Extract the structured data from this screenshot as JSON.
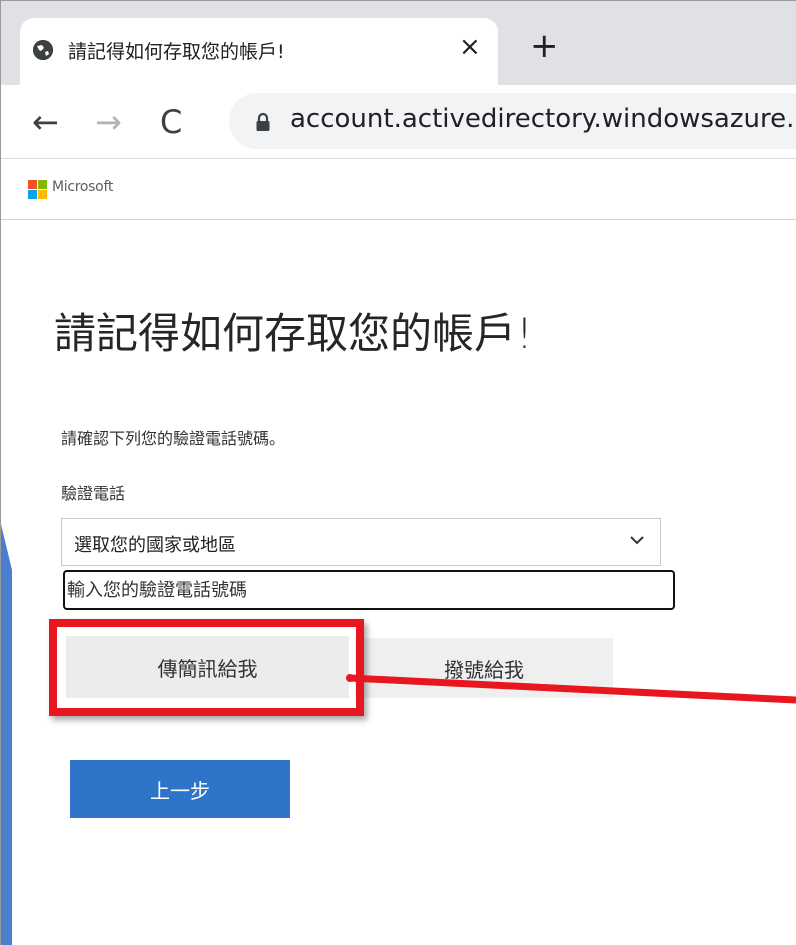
{
  "browser": {
    "tab_title": "請記得如何存取您的帳戶!",
    "tab_close": "×",
    "new_tab": "+",
    "url": "account.activedirectory.windowsazure.",
    "back_icon": "←",
    "forward_icon": "→",
    "reload_icon": "C"
  },
  "brand": {
    "name": "Microsoft",
    "logo_colors": [
      "#f25022",
      "#7fba00",
      "#00a4ef",
      "#ffb900"
    ]
  },
  "page": {
    "heading": "請記得如何存取您的帳戶!",
    "instruction": "請確認下列您的驗證電話號碼。",
    "field_label": "驗證電話",
    "country_select": "選取您的國家或地區",
    "phone_placeholder": "輸入您的驗證電話號碼",
    "text_me_button": "傳簡訊給我",
    "call_me_button": "撥號給我",
    "back_button": "上一步"
  },
  "colors": {
    "accent_blue": "#2e74c8",
    "highlight_red": "#e8171f",
    "wedge_blue": "#4a7fd0"
  }
}
